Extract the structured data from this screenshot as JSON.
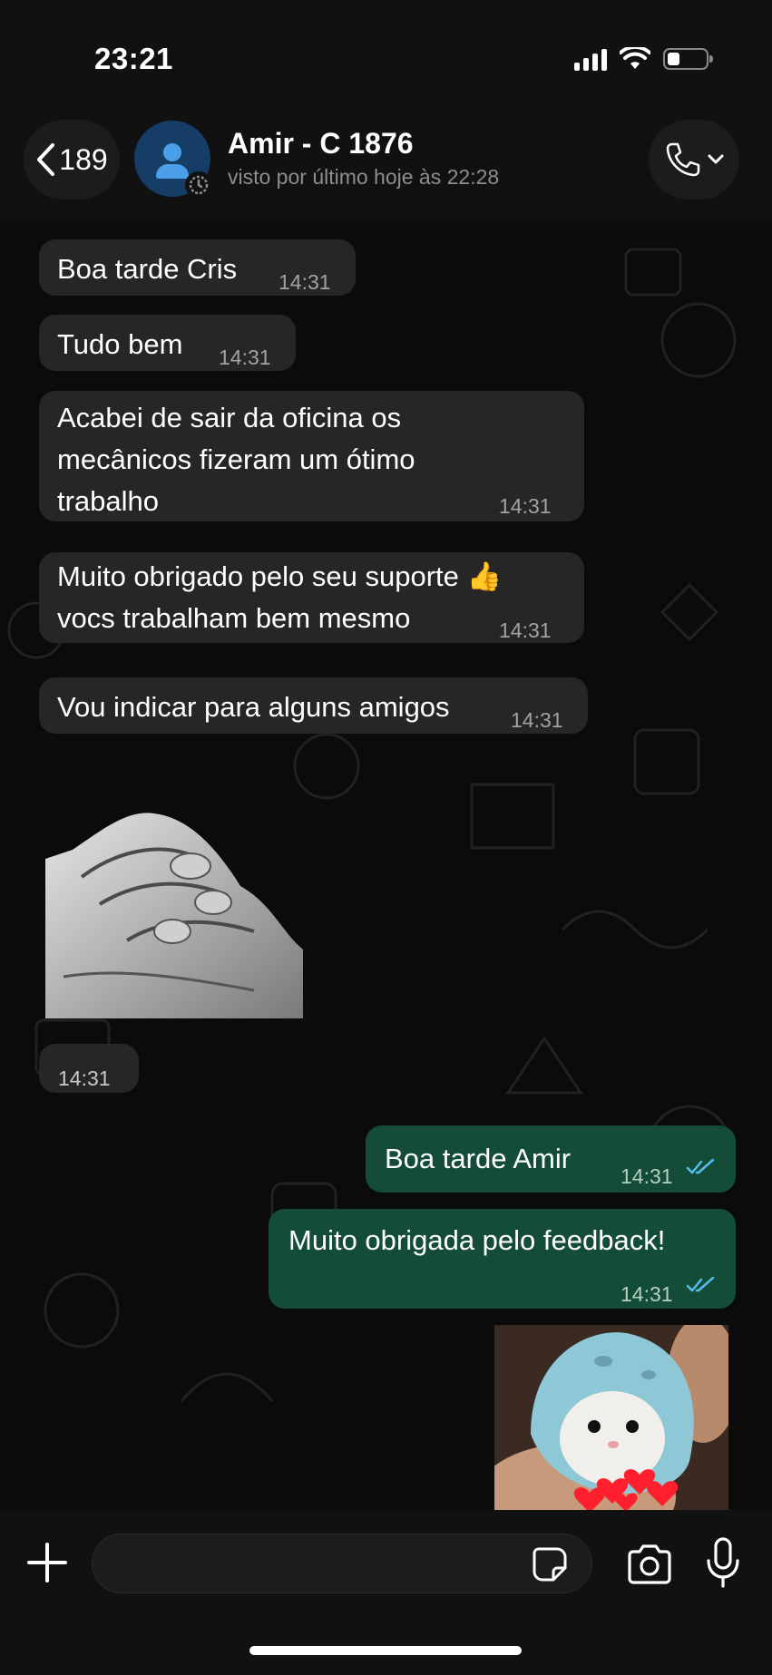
{
  "status_bar": {
    "time": "23:21"
  },
  "header": {
    "back_count": "189",
    "contact_name": "Amir - C 1876",
    "contact_status": "visto por último hoje às 22:28"
  },
  "messages": {
    "m1": {
      "text": "Boa tarde Cris",
      "time": "14:31"
    },
    "m2": {
      "text": "Tudo bem",
      "time": "14:31"
    },
    "m3": {
      "text": "Acabei de sair da oficina os\nmecânicos fizeram um ótimo\ntrabalho",
      "time": "14:31"
    },
    "m4": {
      "text": "Muito obrigado pelo seu suporte 👍\nvocs trabalham bem mesmo",
      "time": "14:31"
    },
    "m5": {
      "text": "Vou indicar para alguns amigos",
      "time": "14:31"
    },
    "sticker_time": "14:31",
    "m6": {
      "text": "Boa tarde Amir",
      "time": "14:31"
    },
    "m7": {
      "text": "Muito obrigada pelo feedback!",
      "time": "14:31"
    }
  },
  "colors": {
    "incoming_bubble": "#262626",
    "outgoing_bubble": "#144d37",
    "read_ticks": "#53bdeb"
  },
  "icons": [
    "back-chevron-icon",
    "contact-avatar-icon",
    "disappearing-timer-icon",
    "phone-icon",
    "chevron-down-icon",
    "double-check-icon",
    "plus-icon",
    "sticker-icon",
    "camera-icon",
    "microphone-icon"
  ]
}
